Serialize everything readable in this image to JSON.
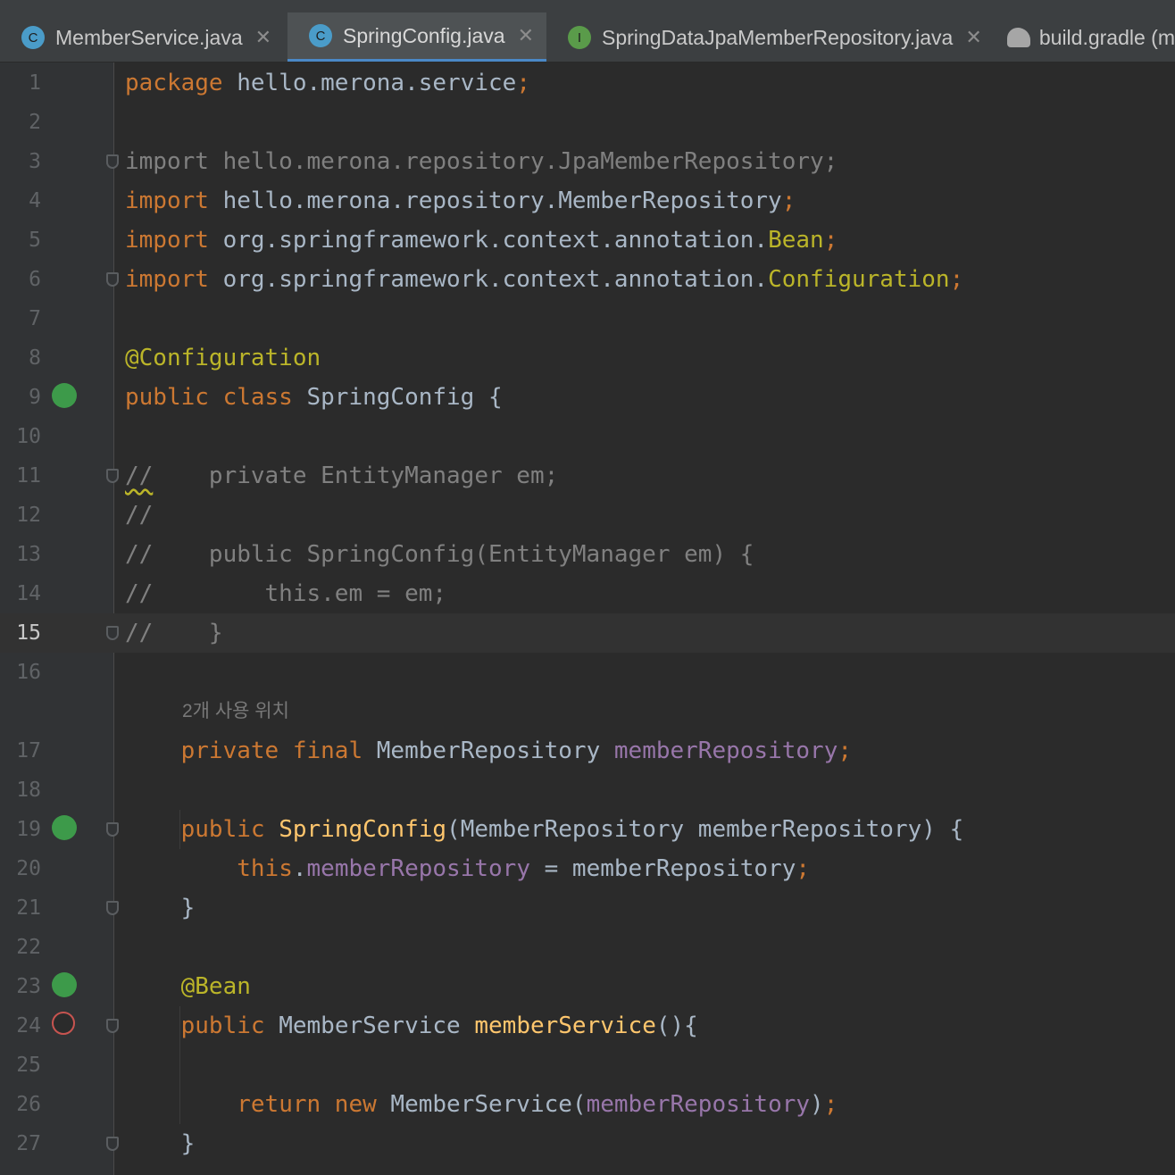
{
  "tabs": [
    {
      "label": "MemberService.java",
      "icon": "C",
      "icon_color": "#4a9cc9",
      "close": "✕"
    },
    {
      "label": "SpringConfig.java",
      "icon": "C",
      "icon_color": "#4a9cc9",
      "close": "✕",
      "active": true
    },
    {
      "label": "SpringDataJpaMemberRepository.java",
      "icon": "I",
      "icon_color": "#5a9b4a",
      "close": "✕"
    },
    {
      "label": "build.gradle (m",
      "icon": "gradle"
    }
  ],
  "current_line": 15,
  "lines": [
    {
      "n": "1",
      "tokens": [
        [
          "kw",
          "package "
        ],
        [
          "",
          "hello.merona.service"
        ],
        [
          "kw",
          ";"
        ]
      ]
    },
    {
      "n": "2",
      "tokens": []
    },
    {
      "n": "3",
      "tokens": [
        [
          "gray",
          "import hello.merona.repository.JpaMemberRepository;"
        ]
      ]
    },
    {
      "n": "4",
      "tokens": [
        [
          "kw",
          "import "
        ],
        [
          "",
          "hello.merona.repository.MemberRepository"
        ],
        [
          "kw",
          ";"
        ]
      ]
    },
    {
      "n": "5",
      "tokens": [
        [
          "kw",
          "import "
        ],
        [
          "",
          "org.springframework.context.annotation."
        ],
        [
          "ann",
          "Bean"
        ],
        [
          "kw",
          ";"
        ]
      ]
    },
    {
      "n": "6",
      "tokens": [
        [
          "kw",
          "import "
        ],
        [
          "",
          "org.springframework.context.annotation."
        ],
        [
          "ann",
          "Configuration"
        ],
        [
          "kw",
          ";"
        ]
      ]
    },
    {
      "n": "7",
      "tokens": []
    },
    {
      "n": "8",
      "tokens": [
        [
          "ann",
          "@Configuration"
        ]
      ]
    },
    {
      "n": "9",
      "tokens": [
        [
          "kw",
          "public class "
        ],
        [
          "",
          "SpringConfig {"
        ]
      ]
    },
    {
      "n": "10",
      "tokens": []
    },
    {
      "n": "11",
      "tokens": [
        [
          "cmt squig",
          "//"
        ],
        [
          "cmt",
          "    private EntityManager em;"
        ]
      ]
    },
    {
      "n": "12",
      "tokens": [
        [
          "cmt",
          "//"
        ]
      ]
    },
    {
      "n": "13",
      "tokens": [
        [
          "cmt",
          "//    public SpringConfig(EntityManager em) {"
        ]
      ]
    },
    {
      "n": "14",
      "tokens": [
        [
          "cmt",
          "//        this.em = em;"
        ]
      ]
    },
    {
      "n": "15",
      "tokens": [
        [
          "cmt",
          "//    }"
        ]
      ]
    },
    {
      "n": "16",
      "tokens": []
    },
    {
      "n": "",
      "hint": "2개 사용 위치"
    },
    {
      "n": "17",
      "tokens": [
        [
          "",
          "    "
        ],
        [
          "kw",
          "private final "
        ],
        [
          "",
          "MemberRepository "
        ],
        [
          "fld",
          "memberRepository"
        ],
        [
          "kw",
          ";"
        ]
      ]
    },
    {
      "n": "18",
      "tokens": []
    },
    {
      "n": "19",
      "tokens": [
        [
          "",
          "    "
        ],
        [
          "kw",
          "public "
        ],
        [
          "fn",
          "SpringConfig"
        ],
        [
          "",
          "(MemberRepository memberRepository) {"
        ]
      ]
    },
    {
      "n": "20",
      "tokens": [
        [
          "",
          "        "
        ],
        [
          "kw",
          "this"
        ],
        [
          "",
          "."
        ],
        [
          "fld",
          "memberRepository"
        ],
        [
          "",
          " = memberRepository"
        ],
        [
          "kw",
          ";"
        ]
      ]
    },
    {
      "n": "21",
      "tokens": [
        [
          "",
          "    }"
        ]
      ]
    },
    {
      "n": "22",
      "tokens": []
    },
    {
      "n": "23",
      "tokens": [
        [
          "",
          "    "
        ],
        [
          "ann",
          "@Bean"
        ]
      ]
    },
    {
      "n": "24",
      "tokens": [
        [
          "",
          "    "
        ],
        [
          "kw",
          "public "
        ],
        [
          "",
          "MemberService "
        ],
        [
          "fn",
          "memberService"
        ],
        [
          "",
          "(){"
        ]
      ]
    },
    {
      "n": "25",
      "tokens": []
    },
    {
      "n": "26",
      "tokens": [
        [
          "",
          "        "
        ],
        [
          "kw",
          "return new "
        ],
        [
          "",
          "MemberService("
        ],
        [
          "fld",
          "memberRepository"
        ],
        [
          "",
          ")"
        ],
        [
          "kw",
          ";"
        ]
      ]
    },
    {
      "n": "27",
      "tokens": [
        [
          "",
          "    }"
        ]
      ]
    }
  ],
  "colors": {
    "keyword": "#cc7832",
    "annotation": "#bbb529",
    "field": "#9876aa",
    "method": "#ffc66d",
    "comment": "#808080",
    "text": "#a9b7c6"
  }
}
